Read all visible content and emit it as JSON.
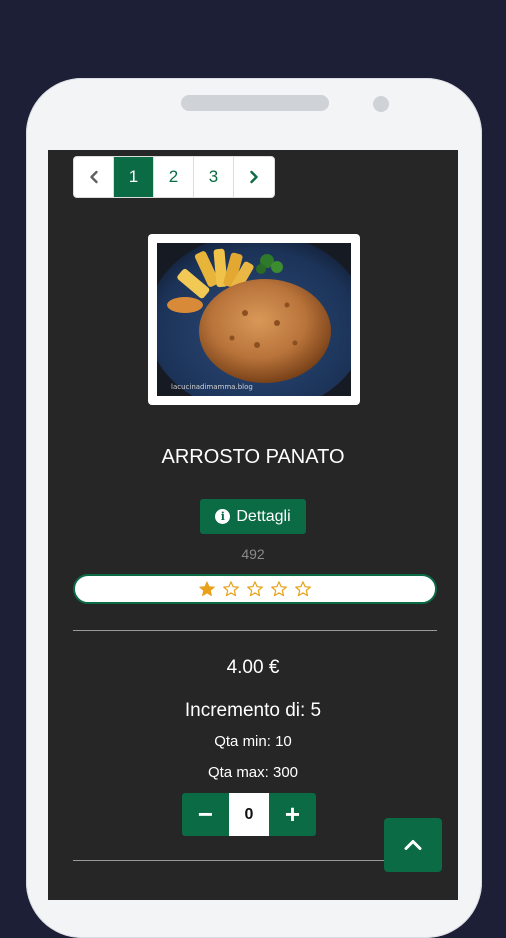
{
  "pagination": {
    "prev_icon": "chevron-left-icon",
    "pages": [
      "1",
      "2",
      "3"
    ],
    "active_page": "1",
    "next_icon": "chevron-right-icon"
  },
  "product": {
    "title": "ARROSTO PANATO",
    "image_watermark": "lacucinadimamma.blog",
    "details_label": "Dettagli",
    "details_icon": "info-icon",
    "views": "492",
    "rating": 1,
    "rating_max": 5,
    "price": "4.00 €",
    "increment": "Incremento di: 5",
    "qty_min": "Qta min: 10",
    "qty_max": "Qta max: 300",
    "quantity": "0",
    "minus_label": "−",
    "plus_label": "+"
  },
  "colors": {
    "accent": "#0a6b45",
    "star_filled": "#e8a21a",
    "background": "#262626"
  },
  "scroll_top_icon": "chevron-up-icon"
}
